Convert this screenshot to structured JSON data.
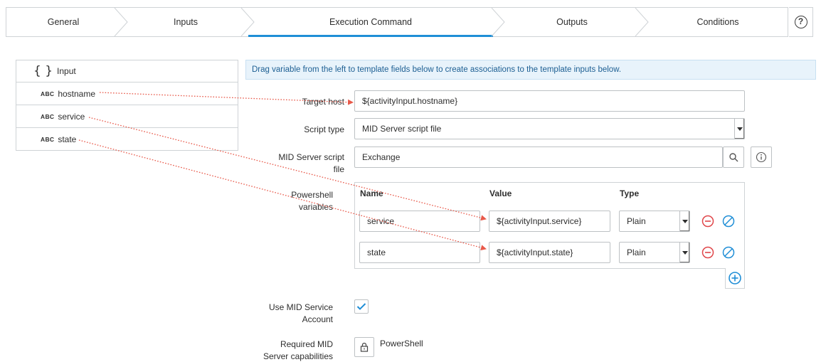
{
  "wizard": {
    "tabs": [
      {
        "label": "General"
      },
      {
        "label": "Inputs"
      },
      {
        "label": "Execution Command"
      },
      {
        "label": "Outputs"
      },
      {
        "label": "Conditions"
      }
    ],
    "active_tab": "Execution Command",
    "help_glyph": "?"
  },
  "variables": {
    "header": "Input",
    "brace_glyph": "{ }",
    "type_badge": "ABC",
    "items": [
      {
        "name": "hostname"
      },
      {
        "name": "service"
      },
      {
        "name": "state"
      }
    ]
  },
  "info_banner": "Drag variable from the left to template fields below to create associations to the template inputs below.",
  "form": {
    "target_host_label": "Target host",
    "target_host_value": "${activityInput.hostname}",
    "script_type_label": "Script type",
    "script_type_value": "MID Server script file",
    "mid_script_label_1": "MID Server script",
    "mid_script_label_2": "file",
    "mid_script_value": "Exchange",
    "ps_vars_label_1": "Powershell",
    "ps_vars_label_2": "variables",
    "grid_headers": {
      "name": "Name",
      "value": "Value",
      "type": "Type"
    },
    "ps_vars": [
      {
        "name": "service",
        "value": "${activityInput.service}",
        "type": "Plain"
      },
      {
        "name": "state",
        "value": "${activityInput.state}",
        "type": "Plain"
      }
    ],
    "use_mid_label_1": "Use MID Service",
    "use_mid_label_2": "Account",
    "use_mid_checked": true,
    "capabilities_label_1": "Required MID",
    "capabilities_label_2": "Server capabilities",
    "capability_value": "PowerShell"
  },
  "colors": {
    "accent": "#1f8ed6",
    "arrow": "#e8594a",
    "remove": "#e0464a",
    "info_bg": "#e8f3fb"
  },
  "icons": [
    "help-icon",
    "braces-icon",
    "search-icon",
    "info-icon",
    "remove-icon",
    "clear-icon",
    "add-icon",
    "checkmark-icon",
    "lock-icon"
  ]
}
